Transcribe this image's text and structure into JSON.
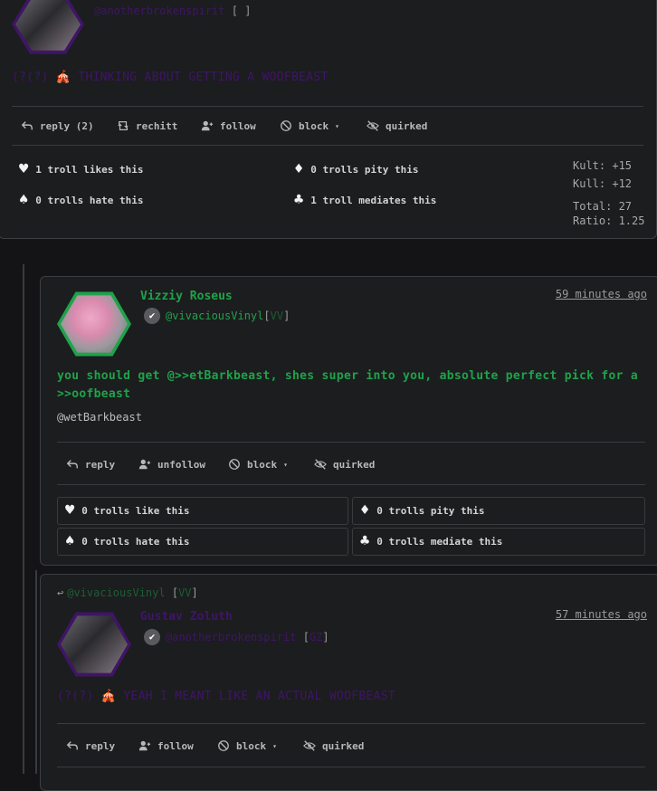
{
  "post1": {
    "handle": "@anotherbrokenspirit",
    "handle_tag": " ",
    "text": "(?(?) 🎪 THINKING ABOUT GETTING A WOOFBEAST",
    "actions": {
      "reply": "reply (2)",
      "rechitt": "rechitt",
      "follow": "follow",
      "block": "block",
      "quirked": "quirked"
    },
    "stats": {
      "like": "1 troll likes this",
      "pity": "0 trolls pity this",
      "hate": "0 trolls hate this",
      "mediate": "1 troll mediates this"
    },
    "scores": {
      "kult": "Kult: +15",
      "kull": "Kull: +12",
      "total": "Total: 27",
      "ratio": "Ratio: 1.25"
    }
  },
  "post2": {
    "name": "Vizziy Roseus",
    "handle": "@vivaciousVinyl",
    "tag": "VV",
    "time": "59 minutes ago",
    "text": "you should get @>>etBarkbeast, shes super into you, absolute perfect pick for a >>oofbeast",
    "mention": "@wetBarkbeast",
    "actions": {
      "reply": "reply",
      "follow": "unfollow",
      "block": "block",
      "quirked": "quirked"
    },
    "stats": {
      "like": "0 trolls like this",
      "pity": "0 trolls pity this",
      "hate": "0 trolls hate this",
      "mediate": "0 trolls mediate this"
    }
  },
  "post3": {
    "reply_to": "@vivaciousVinyl",
    "reply_tag": "VV",
    "name": "Gustav Zoluth",
    "handle": "@anotherbrokenspirit",
    "tag": "GZ",
    "time": "57 minutes ago",
    "text": "(?(?) 🎪 YEAH I MEANT LIKE AN ACTUAL WOOFBEAST",
    "actions": {
      "reply": "reply",
      "follow": "follow",
      "block": "block",
      "quirked": "quirked"
    }
  },
  "colors": {
    "green": "#1fa34a",
    "purple": "#3f1566",
    "card_bg": "#1c1d1f"
  }
}
